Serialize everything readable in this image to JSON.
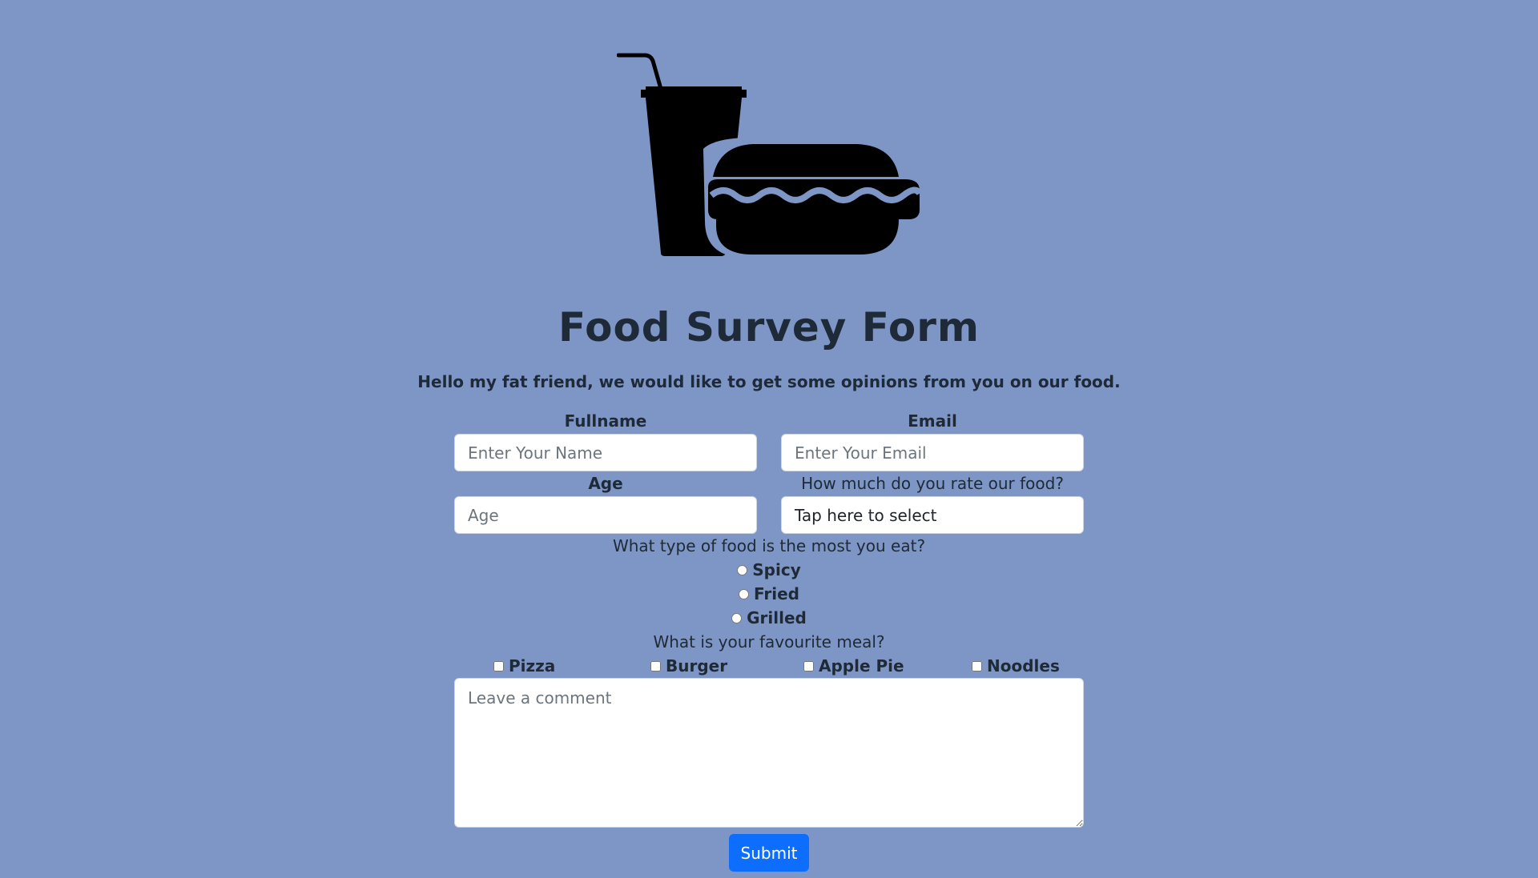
{
  "header": {
    "logo_icon": "drink-and-hotdog-icon",
    "title": "Food Survey Form",
    "subtitle": "Hello my fat friend, we would like to get some opinions from you on our food."
  },
  "form": {
    "fullname": {
      "label": "Fullname",
      "placeholder": "Enter Your Name",
      "value": ""
    },
    "email": {
      "label": "Email",
      "placeholder": "Enter Your Email",
      "value": ""
    },
    "age": {
      "label": "Age",
      "placeholder": "Age",
      "value": ""
    },
    "rating": {
      "label": "How much do you rate our food?",
      "selected": "Tap here to select"
    },
    "food_type": {
      "question": "What type of food is the most you eat?",
      "options": [
        "Spicy",
        "Fried",
        "Grilled"
      ]
    },
    "favourite_meal": {
      "question": "What is your favourite meal?",
      "options": [
        "Pizza",
        "Burger",
        "Apple Pie",
        "Noodles"
      ]
    },
    "comment": {
      "placeholder": "Leave a comment",
      "value": ""
    },
    "submit_label": "Submit"
  },
  "colors": {
    "background": "#7d96c5",
    "submit": "#0d6efd",
    "text": "#1f2a38"
  }
}
